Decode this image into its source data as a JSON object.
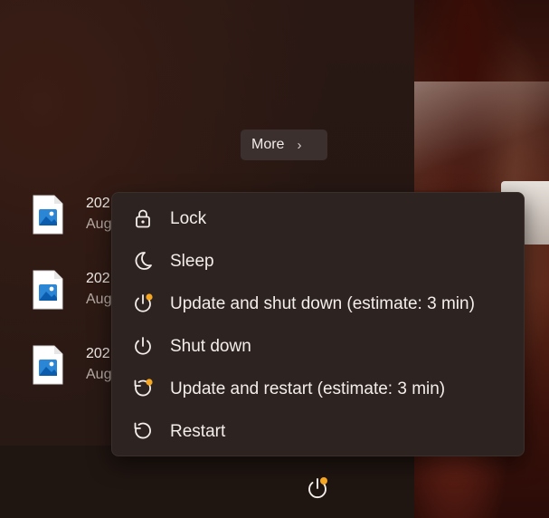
{
  "more_button": {
    "label": "More",
    "chevron": "›"
  },
  "files": [
    {
      "title": "202",
      "subtitle": "Aug",
      "icon": "image-file-icon"
    },
    {
      "title": "202",
      "subtitle": "Aug",
      "icon": "image-file-icon"
    },
    {
      "title": "202",
      "subtitle": "Aug",
      "icon": "image-file-icon"
    }
  ],
  "power_menu": {
    "items": [
      {
        "label": "Lock",
        "icon": "lock-icon"
      },
      {
        "label": "Sleep",
        "icon": "moon-icon"
      },
      {
        "label": "Update and shut down (estimate: 3 min)",
        "icon": "power-update-icon"
      },
      {
        "label": "Shut down",
        "icon": "power-icon"
      },
      {
        "label": "Update and restart (estimate: 3 min)",
        "icon": "restart-update-icon"
      },
      {
        "label": "Restart",
        "icon": "restart-icon"
      }
    ]
  },
  "colors": {
    "menu_bg": "#2d2320",
    "text": "#f3eeea",
    "update_badge": "#f5a623",
    "file_icon_blue": "#2b86d6"
  }
}
